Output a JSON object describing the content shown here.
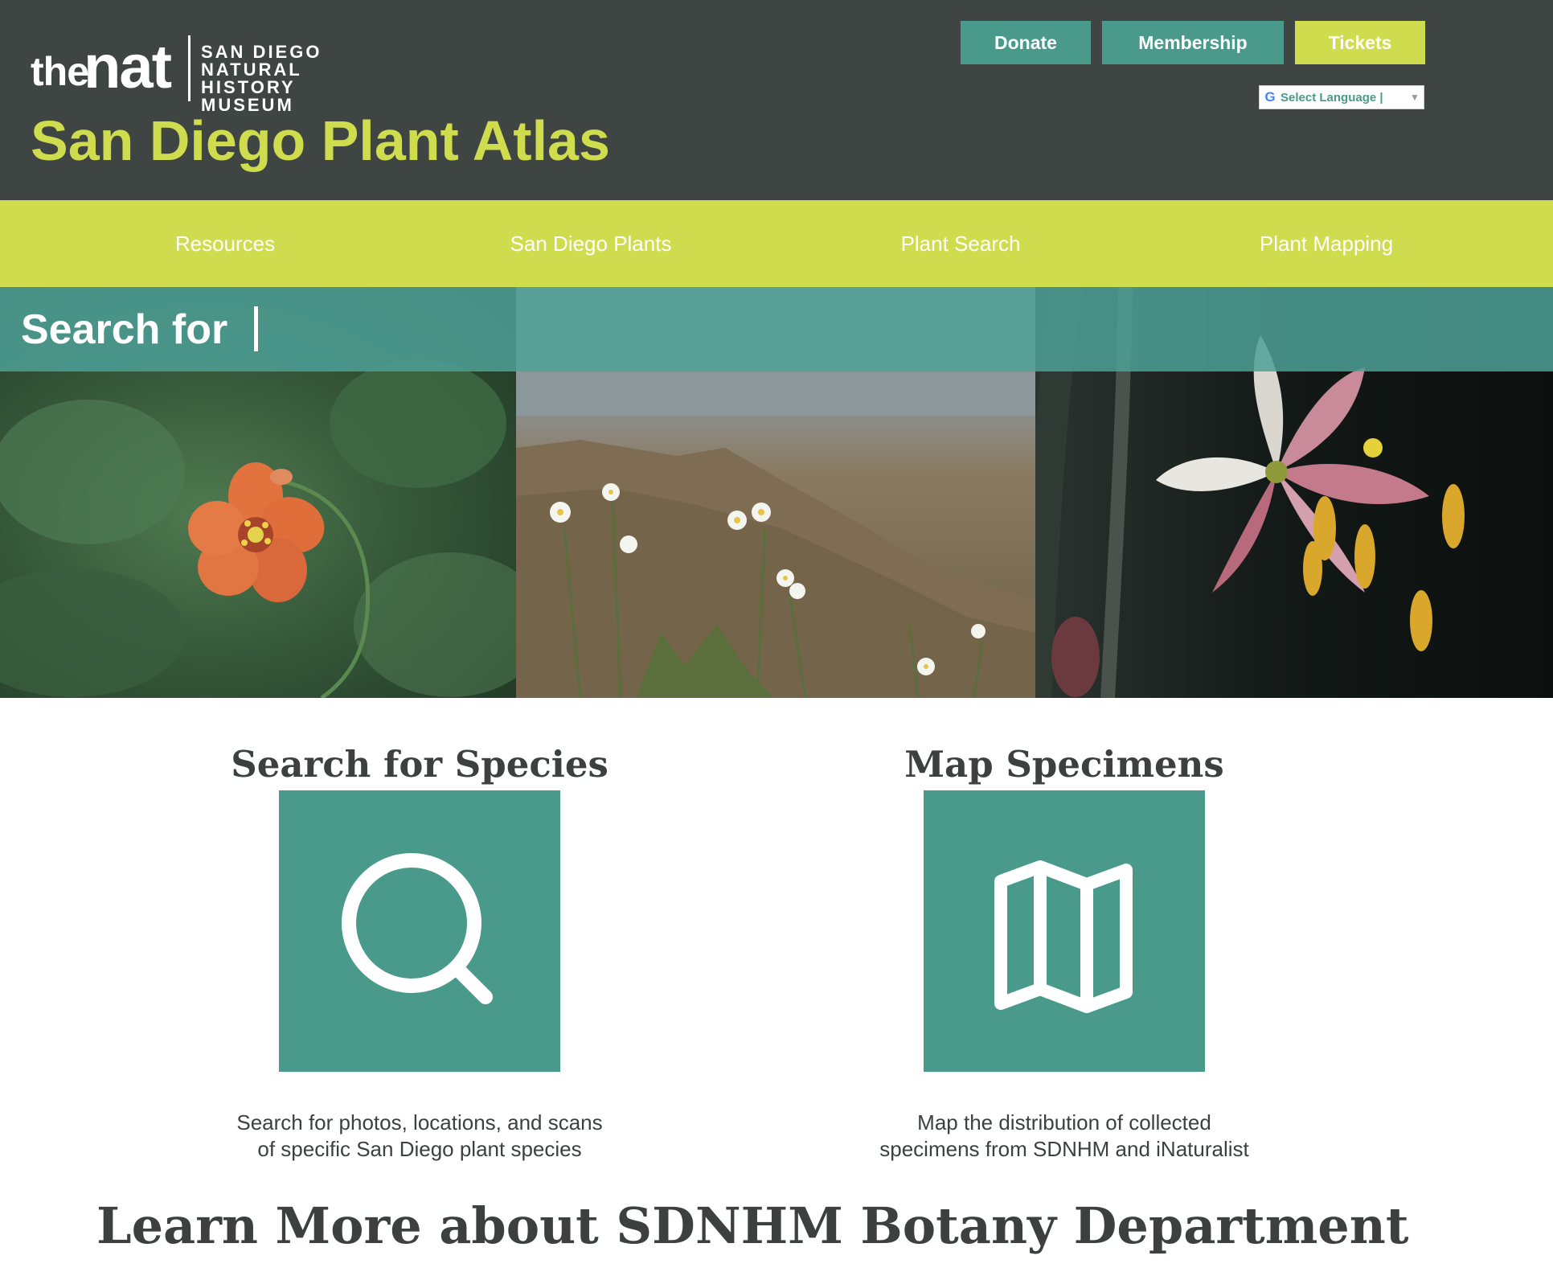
{
  "header": {
    "logo": {
      "the": "the",
      "nat": "nat",
      "lines": [
        "SAN DIEGO",
        "NATURAL HISTORY",
        "MUSEUM"
      ]
    },
    "site_title": "San Diego Plant Atlas",
    "buttons": {
      "donate": "Donate",
      "membership": "Membership",
      "tickets": "Tickets"
    },
    "language_select": {
      "icon": "google-g-icon",
      "label": "Select Language",
      "separator": "|"
    }
  },
  "nav": {
    "items": [
      {
        "label": "Resources"
      },
      {
        "label": "San Diego Plants"
      },
      {
        "label": "Plant Search"
      },
      {
        "label": "Plant Mapping"
      }
    ]
  },
  "hero": {
    "search_label": "Search for"
  },
  "features": [
    {
      "title": "Search for Species",
      "icon": "search-icon",
      "description_line1": "Search for photos, locations, and scans",
      "description_line2": "of specific San Diego plant species"
    },
    {
      "title": "Map Specimens",
      "icon": "map-icon",
      "description_line1": "Map the distribution of collected",
      "description_line2": "specimens from SDNHM and iNaturalist"
    }
  ],
  "learn_more": "Learn More about SDNHM Botany Department",
  "colors": {
    "header_bg": "#3f4543",
    "accent_lime": "#cfdc4e",
    "accent_teal": "#4a9a8c",
    "text_dark": "#3c403f"
  }
}
